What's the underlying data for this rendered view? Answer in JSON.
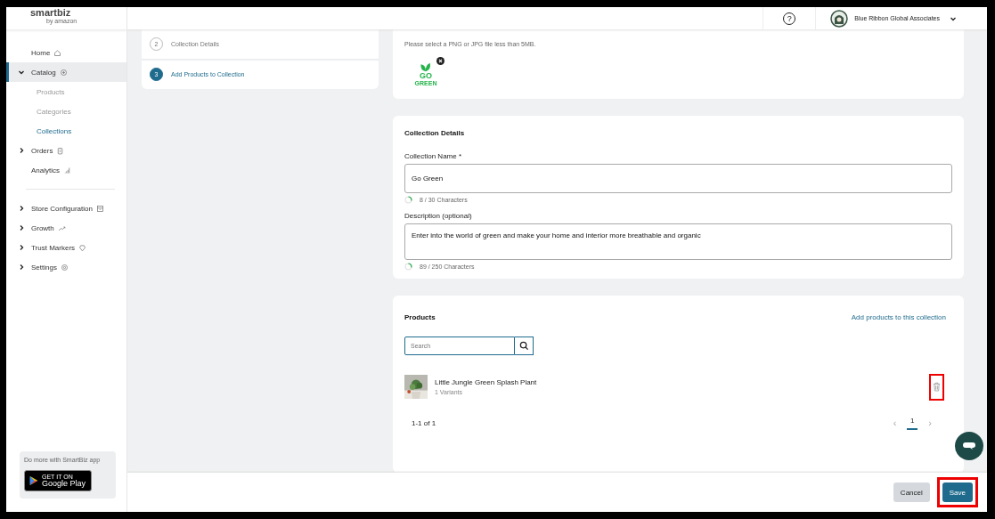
{
  "logo": {
    "name": "smartbiz",
    "tagline": "by amazon"
  },
  "header": {
    "help": "?",
    "account": "Blue Ribbon Global Associates"
  },
  "sidebar": {
    "items": [
      {
        "label": "Home",
        "expandable": false,
        "expanded": false,
        "selected": false
      },
      {
        "label": "Catalog",
        "expandable": true,
        "expanded": true,
        "selected": true,
        "children": [
          {
            "label": "Products",
            "selected": false
          },
          {
            "label": "Categories",
            "selected": false
          },
          {
            "label": "Collections",
            "selected": true
          }
        ]
      },
      {
        "label": "Orders",
        "expandable": true,
        "expanded": false,
        "selected": false
      },
      {
        "label": "Analytics",
        "expandable": false,
        "expanded": false,
        "selected": false
      },
      {
        "label": "Store Configuration",
        "expandable": true,
        "expanded": false,
        "selected": false,
        "divider_before": true
      },
      {
        "label": "Growth",
        "expandable": true,
        "expanded": false,
        "selected": false
      },
      {
        "label": "Trust Markers",
        "expandable": true,
        "expanded": false,
        "selected": false
      },
      {
        "label": "Settings",
        "expandable": true,
        "expanded": false,
        "selected": false
      }
    ],
    "promo": {
      "text": "Do more with SmartBiz app",
      "store_small": "GET IT ON",
      "store_name": "Google Play"
    }
  },
  "steps": [
    {
      "number": "2",
      "label": "Collection Details",
      "selected": false
    },
    {
      "number": "3",
      "label": "Add Products to Collection",
      "selected": true
    }
  ],
  "upload": {
    "hint": "Please select a PNG or JPG file less than 5MB.",
    "image_lines": [
      "GO",
      "GREEN"
    ]
  },
  "details": {
    "title": "Collection Details",
    "fields": [
      {
        "label": "Collection Name *",
        "value": "Go Green",
        "counter": "8 / 30 Characters",
        "kind": "input"
      },
      {
        "label": "Description (optional)",
        "value": "Enter into the world of green and make your home and interior more breathable and organic",
        "counter": "89 / 250 Characters",
        "kind": "textarea"
      }
    ]
  },
  "products": {
    "title": "Products",
    "add_link": "Add products to this collection",
    "search": {
      "placeholder": "Search"
    },
    "items": [
      {
        "name": "Little Jungle Green Splash Plant",
        "variants": "1 Variants",
        "highlighted": true
      }
    ],
    "range": "1-1 of 1",
    "prev": "‹",
    "next": "›",
    "pages": [
      {
        "label": "1",
        "selected": true
      }
    ]
  },
  "footer": {
    "buttons": [
      {
        "label": "Cancel",
        "kind": "secondary",
        "highlighted": false
      },
      {
        "label": "Save",
        "kind": "primary",
        "highlighted": true
      }
    ]
  }
}
